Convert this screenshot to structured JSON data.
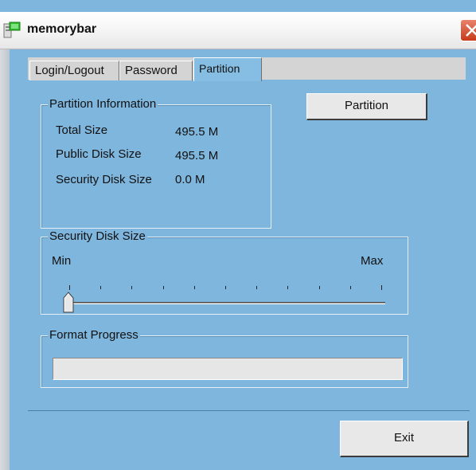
{
  "window": {
    "title": "memorybar"
  },
  "tabs": [
    {
      "label": "Login/Logout"
    },
    {
      "label": "Password"
    },
    {
      "label": "Partition"
    }
  ],
  "partition_info": {
    "legend": "Partition Information",
    "rows": [
      {
        "label": "Total Size",
        "value": "495.5 M"
      },
      {
        "label": "Public Disk Size",
        "value": "495.5 M"
      },
      {
        "label": "Security Disk Size",
        "value": "0.0 M"
      }
    ]
  },
  "partition_button": {
    "label": "Partition"
  },
  "security_disk_size": {
    "legend": "Security Disk Size",
    "min_label": "Min",
    "max_label": "Max",
    "slider_value": 0
  },
  "format_progress": {
    "legend": "Format Progress",
    "progress": 0
  },
  "exit_button": {
    "label": "Exit"
  }
}
